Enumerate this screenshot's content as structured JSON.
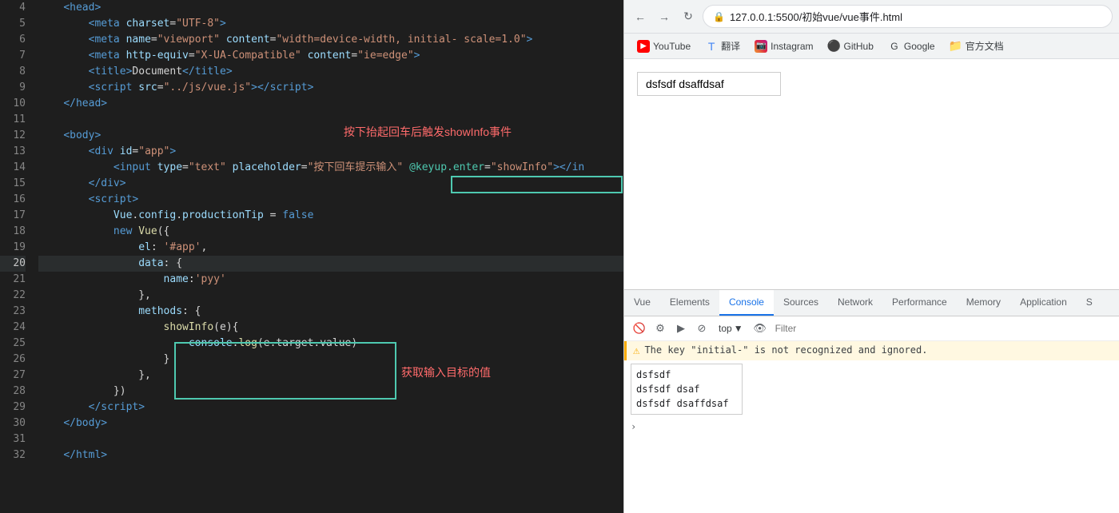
{
  "editor": {
    "lines": [
      {
        "num": 4,
        "content": "    <head>",
        "active": false
      },
      {
        "num": 5,
        "content": "        <meta charset=\"UTF-8\">",
        "active": false
      },
      {
        "num": 6,
        "content": "        <meta name=\"viewport\" content=\"width=device-width, initial- scale=1.0\">",
        "active": false
      },
      {
        "num": 7,
        "content": "        <meta http-equiv=\"X-UA-Compatible\" content=\"ie=edge\">",
        "active": false
      },
      {
        "num": 8,
        "content": "        <title>Document</title>",
        "active": false
      },
      {
        "num": 9,
        "content": "        <script src=\"../js/vue.js\"><\\/script>",
        "active": false
      },
      {
        "num": 10,
        "content": "    </head>",
        "active": false
      },
      {
        "num": 11,
        "content": "",
        "active": false
      },
      {
        "num": 12,
        "content": "    <body>",
        "active": false
      },
      {
        "num": 13,
        "content": "        <div id=\"app\">",
        "active": false
      },
      {
        "num": 14,
        "content": "            <input type=\"text\" placeholder=\"按下回车提示输入\" @keyup.enter=\"showInfo\"></in",
        "active": false
      },
      {
        "num": 15,
        "content": "        </div>",
        "active": false
      },
      {
        "num": 16,
        "content": "        <script>",
        "active": false
      },
      {
        "num": 17,
        "content": "            Vue.config.productionTip = false",
        "active": false
      },
      {
        "num": 18,
        "content": "            new Vue({",
        "active": false
      },
      {
        "num": 19,
        "content": "                el: '#app',",
        "active": false
      },
      {
        "num": 20,
        "content": "                data: {",
        "active": true
      },
      {
        "num": 21,
        "content": "                    name:'pyy'",
        "active": false
      },
      {
        "num": 22,
        "content": "                },",
        "active": false
      },
      {
        "num": 23,
        "content": "                methods: {",
        "active": false
      },
      {
        "num": 24,
        "content": "                    showInfo(e){",
        "active": false
      },
      {
        "num": 25,
        "content": "                        console.log(e.target.value)",
        "active": false
      },
      {
        "num": 26,
        "content": "                    }",
        "active": false
      },
      {
        "num": 27,
        "content": "                },",
        "active": false
      },
      {
        "num": 28,
        "content": "            })",
        "active": false
      },
      {
        "num": 29,
        "content": "        <\\/script>",
        "active": false
      },
      {
        "num": 30,
        "content": "    </body>",
        "active": false
      },
      {
        "num": 31,
        "content": "",
        "active": false
      },
      {
        "num": 32,
        "content": "    </html>",
        "active": false
      }
    ]
  },
  "annotation1": "按下抬起回车后触发showInfo事件",
  "annotation2": "获取输入目标的值",
  "browser": {
    "back_label": "←",
    "forward_label": "→",
    "refresh_label": "↻",
    "url": "127.0.0.1:5500/初始vue/vue事件.html",
    "bookmarks": [
      {
        "label": "YouTube",
        "icon_type": "yt"
      },
      {
        "label": "翻译",
        "icon_type": "translate"
      },
      {
        "label": "Instagram",
        "icon_type": "instagram"
      },
      {
        "label": "GitHub",
        "icon_type": "github"
      },
      {
        "label": "Google",
        "icon_type": "google"
      },
      {
        "label": "官方文档",
        "icon_type": "folder"
      }
    ],
    "input_value": "dsfsdf dsaffdsaf"
  },
  "devtools": {
    "tabs": [
      "Vue",
      "Elements",
      "Console",
      "Sources",
      "Network",
      "Performance",
      "Memory",
      "Application",
      "S"
    ],
    "active_tab": "Console",
    "toolbar": {
      "top_label": "top",
      "filter_placeholder": "Filter"
    },
    "warning_text": "The key \"initial-\" is not recognized and ignored.",
    "console_logs": [
      "dsfsdf",
      "dsfsdf dsaf",
      "dsfsdf dsaffdsaf"
    ]
  }
}
